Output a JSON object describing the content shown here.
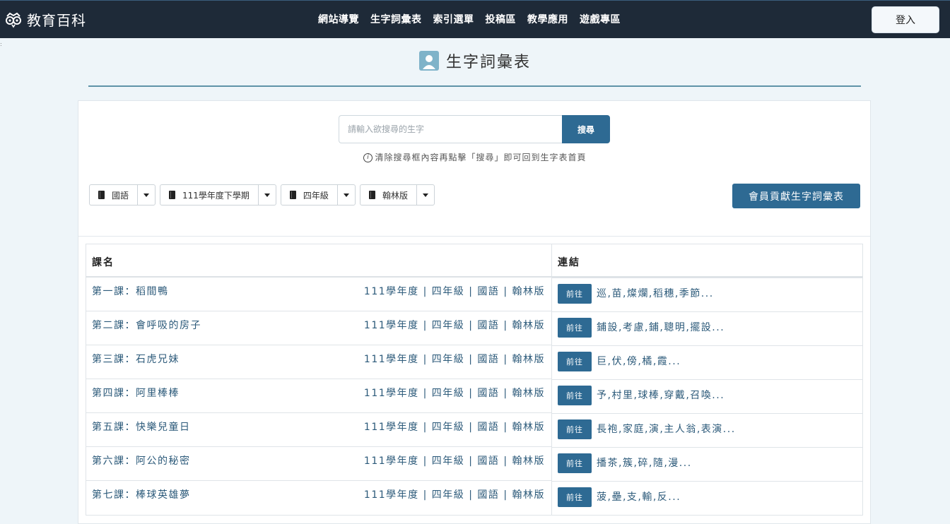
{
  "brand": {
    "name": "教育百科"
  },
  "nav": {
    "items": [
      "網站導覽",
      "生字詞彙表",
      "索引選單",
      "投稿區",
      "教學應用",
      "遊戲專區"
    ]
  },
  "login": {
    "label": "登入"
  },
  "page": {
    "title": "生字詞彙表"
  },
  "search": {
    "placeholder": "請輸入欲搜尋的生字",
    "button": "搜尋",
    "hint": "清除搜尋框內容再點擊「搜尋」即可回到生字表首頁"
  },
  "filters": [
    "國語",
    "111學年度下學期",
    "四年級",
    "翰林版"
  ],
  "contribute": {
    "label": "會員貢獻生字詞彙表"
  },
  "table": {
    "headers": [
      "課名",
      "連結"
    ],
    "go_label": "前往",
    "rows": [
      {
        "title": "第一課：稻間鴨",
        "meta": "111學年度 | 四年級 | 國語 | 翰林版",
        "chars": "巡,苗,燦爛,稻穗,季節..."
      },
      {
        "title": "第二課：會呼吸的房子",
        "meta": "111學年度 | 四年級 | 國語 | 翰林版",
        "chars": "鋪設,考慮,鋪,聰明,擺設..."
      },
      {
        "title": "第三課：石虎兄妹",
        "meta": "111學年度 | 四年級 | 國語 | 翰林版",
        "chars": "巨,伏,傍,橘,霞..."
      },
      {
        "title": "第四課：阿里棒棒",
        "meta": "111學年度 | 四年級 | 國語 | 翰林版",
        "chars": "予,村里,球棒,穿戴,召喚..."
      },
      {
        "title": "第五課：快樂兒童日",
        "meta": "111學年度 | 四年級 | 國語 | 翰林版",
        "chars": "長袍,家庭,演,主人翁,表演..."
      },
      {
        "title": "第六課：阿公的秘密",
        "meta": "111學年度 | 四年級 | 國語 | 翰林版",
        "chars": "播茶,簇,碎,隨,漫..."
      },
      {
        "title": "第七課：棒球英雄夢",
        "meta": "111學年度 | 四年級 | 國語 | 翰林版",
        "chars": "菠,壘,支,輸,反..."
      }
    ]
  }
}
